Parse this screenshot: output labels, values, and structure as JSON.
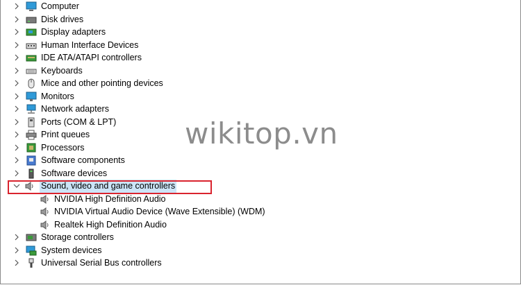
{
  "device_tree": {
    "categories": [
      {
        "label": "Computer",
        "icon": "computer-icon",
        "expanded": false
      },
      {
        "label": "Disk drives",
        "icon": "disk-drive-icon",
        "expanded": false
      },
      {
        "label": "Display adapters",
        "icon": "display-adapter-icon",
        "expanded": false
      },
      {
        "label": "Human Interface Devices",
        "icon": "hid-icon",
        "expanded": false
      },
      {
        "label": "IDE ATA/ATAPI controllers",
        "icon": "ide-controller-icon",
        "expanded": false
      },
      {
        "label": "Keyboards",
        "icon": "keyboard-icon",
        "expanded": false
      },
      {
        "label": "Mice and other pointing devices",
        "icon": "mouse-icon",
        "expanded": false
      },
      {
        "label": "Monitors",
        "icon": "monitor-icon",
        "expanded": false
      },
      {
        "label": "Network adapters",
        "icon": "network-adapter-icon",
        "expanded": false
      },
      {
        "label": "Ports (COM & LPT)",
        "icon": "port-icon",
        "expanded": false
      },
      {
        "label": "Print queues",
        "icon": "printer-icon",
        "expanded": false
      },
      {
        "label": "Processors",
        "icon": "processor-icon",
        "expanded": false
      },
      {
        "label": "Software components",
        "icon": "software-component-icon",
        "expanded": false
      },
      {
        "label": "Software devices",
        "icon": "software-device-icon",
        "expanded": false
      },
      {
        "label": "Sound, video and game controllers",
        "icon": "speaker-icon",
        "expanded": true,
        "selected": true
      },
      {
        "label": "Storage controllers",
        "icon": "storage-controller-icon",
        "expanded": false
      },
      {
        "label": "System devices",
        "icon": "system-device-icon",
        "expanded": false
      },
      {
        "label": "Universal Serial Bus controllers",
        "icon": "usb-icon",
        "expanded": false
      }
    ],
    "sound_children": [
      {
        "label": "NVIDIA High Definition Audio",
        "icon": "speaker-icon"
      },
      {
        "label": "NVIDIA Virtual Audio Device (Wave Extensible) (WDM)",
        "icon": "speaker-icon"
      },
      {
        "label": "Realtek High Definition Audio",
        "icon": "speaker-icon"
      }
    ]
  },
  "watermark": "wikitop.vn",
  "colors": {
    "selection": "#cce4f7",
    "highlight_border": "#d9232e",
    "watermark": "#8c8c8c"
  }
}
